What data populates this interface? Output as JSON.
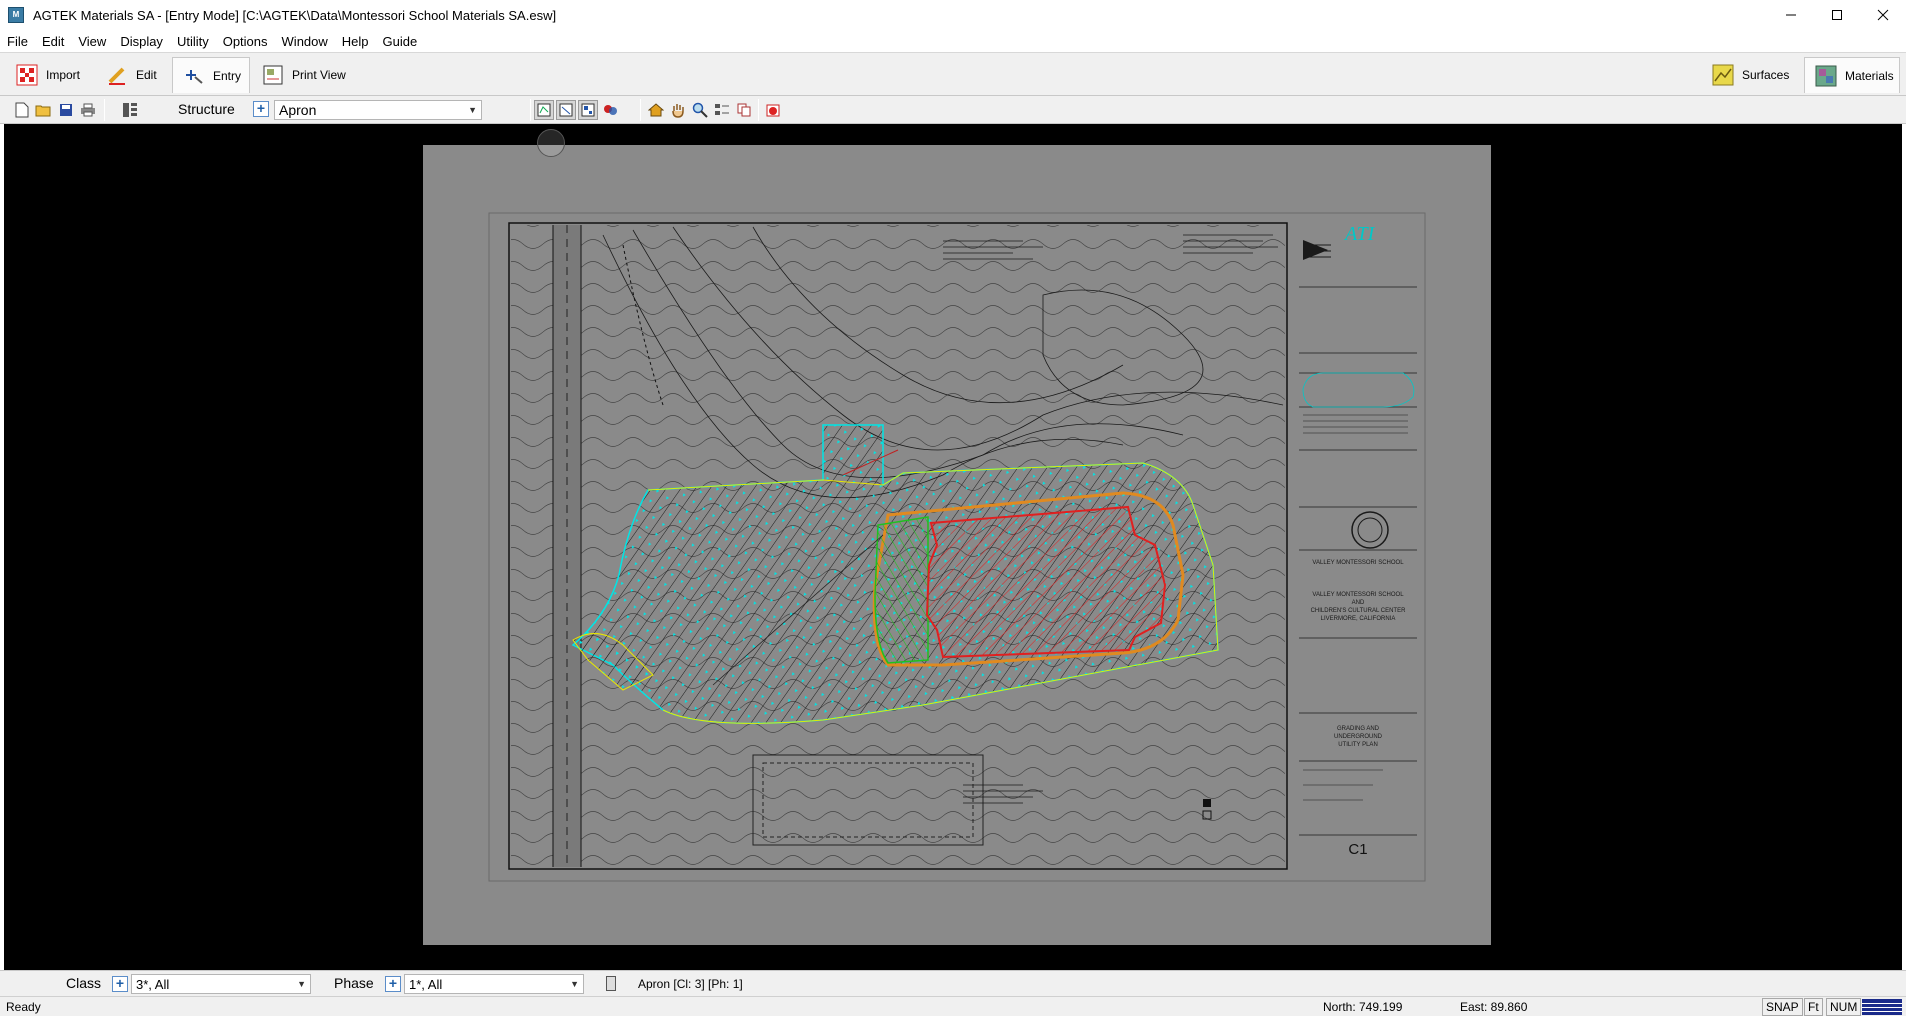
{
  "window": {
    "title": "AGTEK Materials SA - [Entry Mode]  [C:\\AGTEK\\Data\\Montessori School Materials SA.esw]",
    "icon": "agtek-app-icon"
  },
  "menu": [
    {
      "label": "File"
    },
    {
      "label": "Edit"
    },
    {
      "label": "View"
    },
    {
      "label": "Display"
    },
    {
      "label": "Utility"
    },
    {
      "label": "Options"
    },
    {
      "label": "Window"
    },
    {
      "label": "Help"
    },
    {
      "label": "Guide"
    }
  ],
  "ribbon": {
    "import_label": "Import",
    "edit_label": "Edit",
    "entry_label": "Entry",
    "print_view_label": "Print View",
    "surfaces_label": "Surfaces",
    "materials_label": "Materials",
    "active_tab": "Entry"
  },
  "toolbar": {
    "structure_label": "Structure",
    "structure_value": "Apron",
    "icons": [
      "new-file-icon",
      "open-folder-icon",
      "save-icon",
      "print-icon",
      "layers-icon",
      "view-mode-1-icon",
      "view-mode-2-icon",
      "view-mode-3-icon",
      "view-mode-4-icon",
      "home-view-icon",
      "pan-hand-icon",
      "zoom-icon",
      "properties-icon",
      "copy-icon",
      "delete-icon"
    ]
  },
  "drawing": {
    "sheet_number": "C1",
    "logo_text": "ATI",
    "project_line1": "VALLEY MONTESSORI SCHOOL",
    "project_line2": "AND",
    "project_line3": "CHILDREN'S CULTURAL CENTER",
    "project_line4": "LIVERMORE, CALIFORNIA",
    "plan_title1": "GRADING AND",
    "plan_title2": "UNDERGROUND",
    "plan_title3": "UTILITY PLAN",
    "colors": {
      "apron": "#00e5e5",
      "building": "#e02020",
      "landscape": "#20c020",
      "curb": "#e08a20",
      "boundary": "#e8e800"
    }
  },
  "bottom": {
    "class_label": "Class",
    "class_value": "3*, All",
    "phase_label": "Phase",
    "phase_value": "1*, All",
    "selection_info": "Apron [Cl: 3] [Ph: 1]"
  },
  "status": {
    "ready": "Ready",
    "north": "North: 749.199",
    "east": "East: 89.860",
    "snap": "SNAP",
    "units": "Ft",
    "num": "NUM"
  }
}
